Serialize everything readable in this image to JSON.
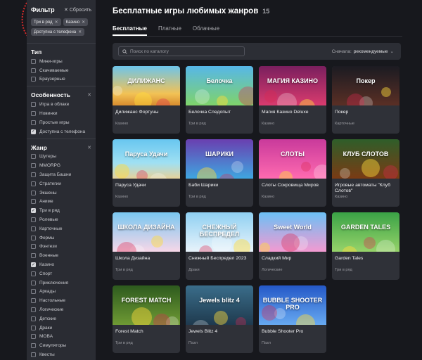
{
  "filter": {
    "title": "Фильтр",
    "reset_label": "Сбросить",
    "chips": [
      "Три в ряд",
      "Казино",
      "Доступна с телефона"
    ]
  },
  "sections": [
    {
      "title": "Тип",
      "has_close": false,
      "options": [
        {
          "label": "Мини-игры",
          "checked": false
        },
        {
          "label": "Скачиваемые",
          "checked": false
        },
        {
          "label": "Браузерные",
          "checked": false
        }
      ]
    },
    {
      "title": "Особенность",
      "has_close": true,
      "options": [
        {
          "label": "Игра в облаке",
          "checked": false
        },
        {
          "label": "Новинки",
          "checked": false
        },
        {
          "label": "Простые игры",
          "checked": false
        },
        {
          "label": "Доступна с телефона",
          "checked": true
        }
      ]
    },
    {
      "title": "Жанр",
      "has_close": true,
      "options": [
        {
          "label": "Шутеры",
          "checked": false
        },
        {
          "label": "MMORPG",
          "checked": false
        },
        {
          "label": "Защита Башни",
          "checked": false
        },
        {
          "label": "Стратегии",
          "checked": false
        },
        {
          "label": "Экшены",
          "checked": false
        },
        {
          "label": "Аниме",
          "checked": false
        },
        {
          "label": "Три в ряд",
          "checked": true
        },
        {
          "label": "Ролевые",
          "checked": false
        },
        {
          "label": "Карточные",
          "checked": false
        },
        {
          "label": "Фермы",
          "checked": false
        },
        {
          "label": "Фэнтези",
          "checked": false
        },
        {
          "label": "Военные",
          "checked": false
        },
        {
          "label": "Казино",
          "checked": true
        },
        {
          "label": "Спорт",
          "checked": false
        },
        {
          "label": "Приключения",
          "checked": false
        },
        {
          "label": "Аркады",
          "checked": false
        },
        {
          "label": "Настольные",
          "checked": false
        },
        {
          "label": "Логические",
          "checked": false
        },
        {
          "label": "Детские",
          "checked": false
        },
        {
          "label": "Драки",
          "checked": false
        },
        {
          "label": "MOBA",
          "checked": false
        },
        {
          "label": "Симуляторы",
          "checked": false
        },
        {
          "label": "Квесты",
          "checked": false
        }
      ]
    }
  ],
  "header": {
    "title": "Бесплатные игры любимых жанров",
    "count": "15"
  },
  "tabs": [
    {
      "label": "Бесплатные",
      "active": true
    },
    {
      "label": "Платные",
      "active": false
    },
    {
      "label": "Облачные",
      "active": false
    }
  ],
  "toolbar": {
    "search_placeholder": "Поиск по каталогу",
    "sort_prefix": "Сначала:",
    "sort_value": "рекомендуемые"
  },
  "games": [
    {
      "name": "Дилижанс Фортуны",
      "genre": "Казино",
      "art": "ДИЛИЖАНС",
      "thumb": "t1"
    },
    {
      "name": "Белочка Следопыт",
      "genre": "Три в ряд",
      "art": "Белочка",
      "thumb": "t2"
    },
    {
      "name": "Магия Казино Deluxe",
      "genre": "Казино",
      "art": "МАГИЯ КАЗИНО",
      "thumb": "t3"
    },
    {
      "name": "Покер",
      "genre": "Карточные",
      "art": "Покер",
      "thumb": "t4"
    },
    {
      "name": "Паруса Удачи",
      "genre": "Казино",
      "art": "Паруса Удачи",
      "thumb": "t5"
    },
    {
      "name": "Баби Шарики",
      "genre": "Три в ряд",
      "art": "ШАРИКИ",
      "thumb": "t6"
    },
    {
      "name": "Слоты Сокровища Миров",
      "genre": "Казино",
      "art": "СЛОТЫ",
      "thumb": "t7"
    },
    {
      "name": "Игровые автоматы \"Клуб Слотов\"",
      "genre": "Казино",
      "art": "КЛУБ СЛОТОВ",
      "thumb": "t8"
    },
    {
      "name": "Школа Дизайна",
      "genre": "Три в ряд",
      "art": "ШКОЛА ДИЗАЙНА",
      "thumb": "t9"
    },
    {
      "name": "Снежный Беспредел 2023",
      "genre": "Драки",
      "art": "СНЕЖНЫЙ БЕСПРЕДЕЛ",
      "thumb": "t10"
    },
    {
      "name": "Сладкий Мир",
      "genre": "Логические",
      "art": "Sweet World",
      "thumb": "t11"
    },
    {
      "name": "Garden Tales",
      "genre": "Три в ряд",
      "art": "GARDEN TALES",
      "thumb": "t12"
    },
    {
      "name": "Forest Match",
      "genre": "Три в ряд",
      "art": "FOREST MATCH",
      "thumb": "t13"
    },
    {
      "name": "Jewels Blitz 4",
      "genre": "Пазл",
      "art": "Jewels blitz 4",
      "thumb": "t14"
    },
    {
      "name": "Bubble Shooter Pro",
      "genre": "Пазл",
      "art": "BUBBLE SHOOTER PRO",
      "thumb": "t15"
    }
  ],
  "colors": {
    "background": "#17181d",
    "sidebar": "#2a2c33",
    "card": "#2f3138",
    "annotation_arrow": "#d62a2a"
  }
}
